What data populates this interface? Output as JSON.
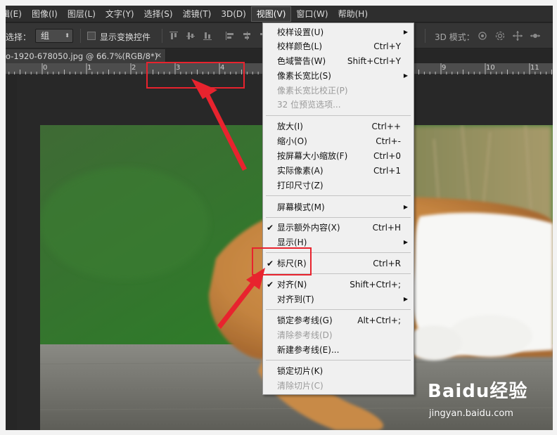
{
  "menubar": {
    "items": [
      "编辑(E)",
      "图像(I)",
      "图层(L)",
      "文字(Y)",
      "选择(S)",
      "滤镜(T)",
      "3D(D)",
      "视图(V)",
      "窗口(W)",
      "帮助(H)"
    ],
    "first_label": "辑(E)",
    "active_index": 7
  },
  "options": {
    "select_label": "选择：",
    "select_value": "组",
    "show_transform_label": "显示变换控件",
    "mode3d_label": "3D 模式："
  },
  "tab": {
    "title": "o-1920-678050.jpg @ 66.7%(RGB/8*)",
    "close": "×"
  },
  "ruler": {
    "numbers": [
      "0",
      "1",
      "2",
      "3",
      "4",
      "9",
      "10",
      "11"
    ]
  },
  "view_menu": {
    "items": [
      {
        "label": "校样设置(U)",
        "shortcut": "",
        "submenu": true,
        "disabled": false,
        "checked": false
      },
      {
        "label": "校样颜色(L)",
        "shortcut": "Ctrl+Y",
        "submenu": false,
        "disabled": false,
        "checked": false
      },
      {
        "label": "色域警告(W)",
        "shortcut": "Shift+Ctrl+Y",
        "submenu": false,
        "disabled": false,
        "checked": false
      },
      {
        "label": "像素长宽比(S)",
        "shortcut": "",
        "submenu": true,
        "disabled": false,
        "checked": false
      },
      {
        "label": "像素长宽比校正(P)",
        "shortcut": "",
        "submenu": false,
        "disabled": true,
        "checked": false
      },
      {
        "label": "32 位预览选项...",
        "shortcut": "",
        "submenu": false,
        "disabled": true,
        "checked": false
      },
      {
        "label": "放大(I)",
        "shortcut": "Ctrl++",
        "submenu": false,
        "disabled": false,
        "checked": false
      },
      {
        "label": "缩小(O)",
        "shortcut": "Ctrl+-",
        "submenu": false,
        "disabled": false,
        "checked": false
      },
      {
        "label": "按屏幕大小缩放(F)",
        "shortcut": "Ctrl+0",
        "submenu": false,
        "disabled": false,
        "checked": false
      },
      {
        "label": "实际像素(A)",
        "shortcut": "Ctrl+1",
        "submenu": false,
        "disabled": false,
        "checked": false
      },
      {
        "label": "打印尺寸(Z)",
        "shortcut": "",
        "submenu": false,
        "disabled": false,
        "checked": false
      },
      {
        "label": "屏幕模式(M)",
        "shortcut": "",
        "submenu": true,
        "disabled": false,
        "checked": false
      },
      {
        "label": "显示额外内容(X)",
        "shortcut": "Ctrl+H",
        "submenu": false,
        "disabled": false,
        "checked": true
      },
      {
        "label": "显示(H)",
        "shortcut": "",
        "submenu": true,
        "disabled": false,
        "checked": false
      },
      {
        "label": "标尺(R)",
        "shortcut": "Ctrl+R",
        "submenu": false,
        "disabled": false,
        "checked": true
      },
      {
        "label": "对齐(N)",
        "shortcut": "Shift+Ctrl+;",
        "submenu": false,
        "disabled": false,
        "checked": true
      },
      {
        "label": "对齐到(T)",
        "shortcut": "",
        "submenu": true,
        "disabled": false,
        "checked": false
      },
      {
        "label": "锁定参考线(G)",
        "shortcut": "Alt+Ctrl+;",
        "submenu": false,
        "disabled": false,
        "checked": false
      },
      {
        "label": "清除参考线(D)",
        "shortcut": "",
        "submenu": false,
        "disabled": true,
        "checked": false
      },
      {
        "label": "新建参考线(E)...",
        "shortcut": "",
        "submenu": false,
        "disabled": false,
        "checked": false
      },
      {
        "label": "锁定切片(K)",
        "shortcut": "",
        "submenu": false,
        "disabled": false,
        "checked": false
      },
      {
        "label": "清除切片(C)",
        "shortcut": "",
        "submenu": false,
        "disabled": true,
        "checked": false
      }
    ]
  },
  "icons": {
    "check": "✔",
    "submenu": "▶",
    "select_arrow": "⬍"
  },
  "watermark": {
    "logo": "Baidu经验",
    "url": "jingyan.baidu.com"
  },
  "colors": {
    "annotation": "#e8232e",
    "menu_bg": "#f0f0f0",
    "app_bg": "#282828"
  }
}
